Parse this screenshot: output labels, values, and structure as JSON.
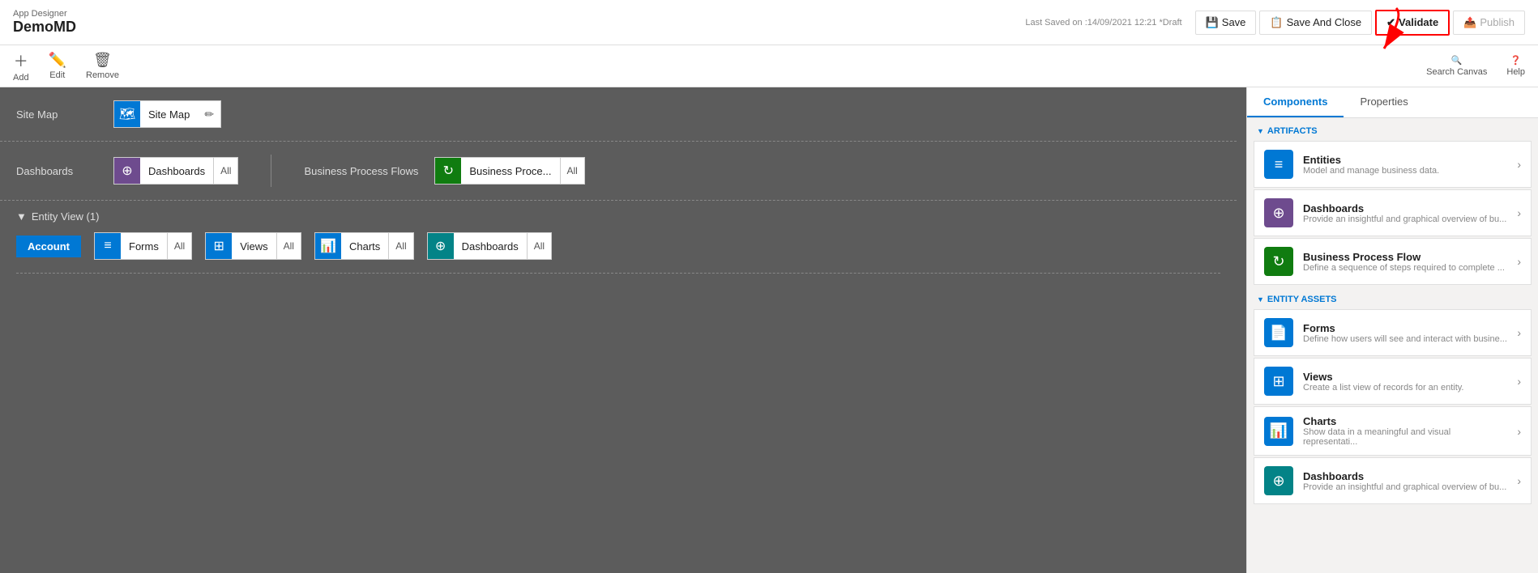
{
  "app": {
    "designer_label": "App Designer",
    "app_name": "DemoMD",
    "last_saved": "Last Saved on :14/09/2021 12:21 *Draft"
  },
  "toolbar_top": {
    "save_label": "Save",
    "save_and_close_label": "Save And Close",
    "validate_label": "Validate",
    "publish_label": "Publish"
  },
  "toolbar": {
    "add_label": "Add",
    "edit_label": "Edit",
    "remove_label": "Remove",
    "search_canvas_label": "Search Canvas",
    "help_label": "Help"
  },
  "canvas": {
    "site_map_label": "Site Map",
    "site_map_name": "Site Map",
    "dashboards_label": "Dashboards",
    "dashboards_name": "Dashboards",
    "dashboards_all": "All",
    "business_process_flows_label": "Business Process Flows",
    "business_process_name": "Business Proce...",
    "business_process_all": "All",
    "entity_view_label": "Entity View (1)",
    "account_label": "Account",
    "forms_name": "Forms",
    "forms_all": "All",
    "views_name": "Views",
    "views_all": "All",
    "charts_name": "Charts",
    "charts_all": "All",
    "entity_dashboards_name": "Dashboards",
    "entity_dashboards_all": "All"
  },
  "right_panel": {
    "components_tab": "Components",
    "properties_tab": "Properties",
    "artifacts_title": "ARTIFACTS",
    "entity_assets_title": "ENTITY ASSETS",
    "entities_title": "Entities",
    "entities_desc": "Model and manage business data.",
    "dashboards_title": "Dashboards",
    "dashboards_desc": "Provide an insightful and graphical overview of bu...",
    "bpf_title": "Business Process Flow",
    "bpf_desc": "Define a sequence of steps required to complete ...",
    "forms_title": "Forms",
    "forms_desc": "Define how users will see and interact with busine...",
    "views_title": "Views",
    "views_desc": "Create a list view of records for an entity.",
    "charts_title": "Charts",
    "charts_desc": "Show data in a meaningful and visual representati...",
    "ea_dashboards_title": "Dashboards",
    "ea_dashboards_desc": "Provide an insightful and graphical overview of bu..."
  }
}
